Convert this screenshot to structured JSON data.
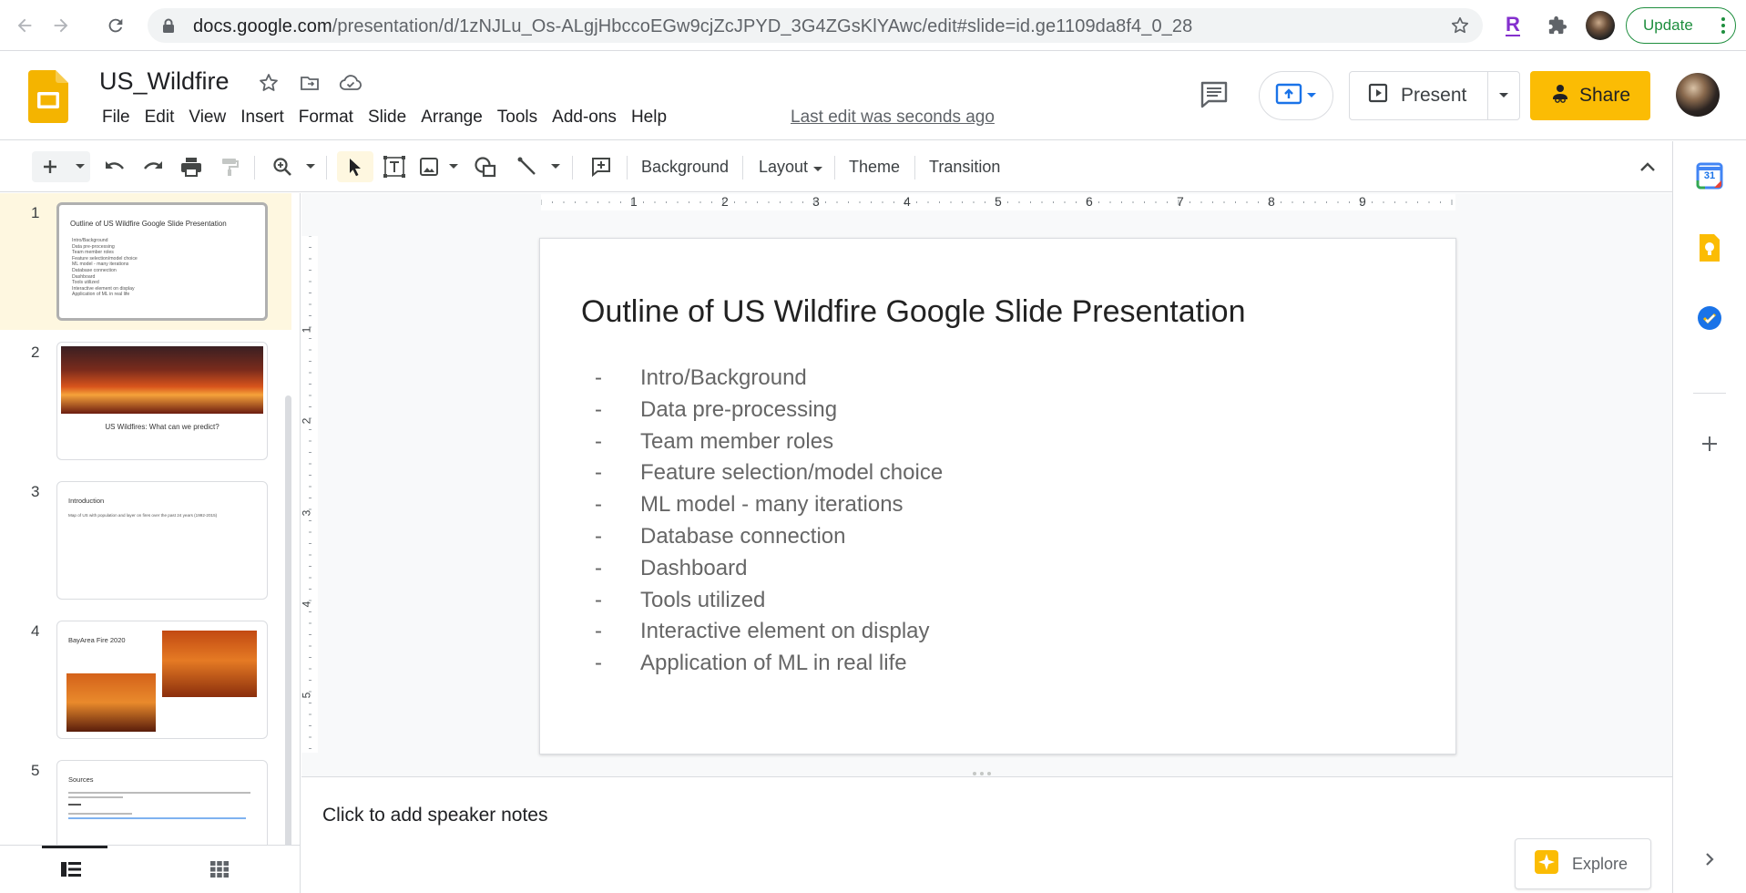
{
  "browser": {
    "url_host": "docs.google.com",
    "url_path": "/presentation/d/1zNJLu_Os-ALgjHbccoEGw9cjZcJPYD_3G4ZGsKlYAwc/edit#slide=id.ge1109da8f4_0_28",
    "update_label": "Update",
    "extension_letter": "R"
  },
  "doc": {
    "title": "US_Wildfire",
    "last_edit": "Last edit was seconds ago"
  },
  "menu": [
    "File",
    "Edit",
    "View",
    "Insert",
    "Format",
    "Slide",
    "Arrange",
    "Tools",
    "Add-ons",
    "Help"
  ],
  "header": {
    "present_label": "Present",
    "share_label": "Share"
  },
  "toolbar": {
    "background_label": "Background",
    "layout_label": "Layout",
    "theme_label": "Theme",
    "transition_label": "Transition"
  },
  "ruler": {
    "h_ticks": [
      "1",
      "2",
      "3",
      "4",
      "5",
      "6",
      "7",
      "8",
      "9"
    ],
    "v_ticks": [
      "1",
      "2",
      "3",
      "4",
      "5"
    ]
  },
  "filmstrip": [
    {
      "number": "1",
      "title": "Outline of US Wildfire Google Slide Presentation",
      "bullets": [
        "Intro/Background",
        "Data pre-processing",
        "Team member roles",
        "Feature selection/model choice",
        "ML model - many iterations",
        "Database connection",
        "Dashboard",
        "Tools utilized",
        "Interactive element on display",
        "Application of ML in real life"
      ]
    },
    {
      "number": "2",
      "caption": "US Wildfires: What can we predict?"
    },
    {
      "number": "3",
      "title": "Introduction",
      "body": "Map of US with population and layer on fires over the past 24 years (1992-2015)"
    },
    {
      "number": "4",
      "title": "BayArea Fire 2020"
    },
    {
      "number": "5",
      "title": "Sources"
    }
  ],
  "slide": {
    "title": "Outline of US Wildfire Google Slide Presentation",
    "bullet_marker": "-",
    "bullets": [
      "Intro/Background",
      "Data pre-processing",
      "Team member roles",
      "Feature selection/model choice",
      "ML model - many iterations",
      "Database connection",
      "Dashboard",
      "Tools utilized",
      "Interactive element on display",
      "Application of ML in real life"
    ]
  },
  "notes": {
    "placeholder": "Click to add speaker notes"
  },
  "explore_label": "Explore",
  "rail": {
    "calendar_day": "31"
  },
  "colors": {
    "accent_yellow": "#fbbc04",
    "selection_bg": "#fef7e0",
    "update_green": "#1e8e3e",
    "link_blue": "#1a73e8"
  }
}
